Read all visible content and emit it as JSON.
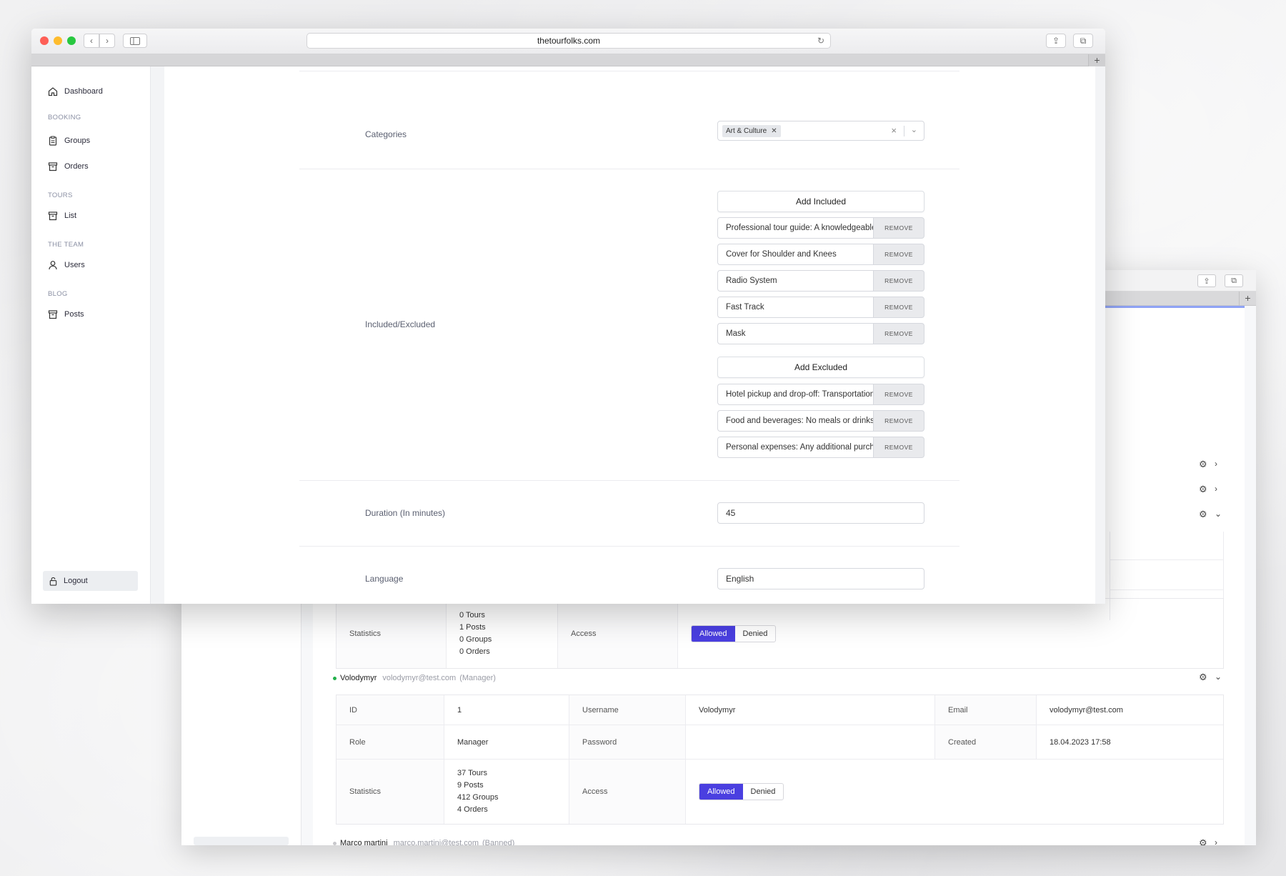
{
  "browser": {
    "url": "thetourfolks.com",
    "traffic_colors": [
      "#fe5f57",
      "#febc2e",
      "#28c840"
    ]
  },
  "sidebar": {
    "dashboard": "Dashboard",
    "sections": [
      {
        "title": "BOOKING",
        "items": [
          "Groups",
          "Orders"
        ]
      },
      {
        "title": "TOURS",
        "items": [
          "List"
        ]
      },
      {
        "title": "THE TEAM",
        "items": [
          "Users"
        ]
      },
      {
        "title": "BLOG",
        "items": [
          "Posts"
        ]
      }
    ],
    "logout": "Logout"
  },
  "form": {
    "categories": {
      "label": "Categories",
      "chips": [
        "Art & Culture"
      ]
    },
    "included_excluded": {
      "label": "Included/Excluded",
      "add_included": "Add Included",
      "included": [
        "Professional tour guide: A knowledgeable guide",
        "Cover for Shoulder and Knees",
        "Radio System",
        "Fast Track",
        "Mask"
      ],
      "add_excluded": "Add Excluded",
      "excluded": [
        "Hotel pickup and drop-off: Transportation",
        "Food and beverages: No meals or drinks",
        "Personal expenses: Any additional purchases"
      ],
      "remove_label": "REMOVE"
    },
    "duration": {
      "label": "Duration (In minutes)",
      "value": "45"
    },
    "language": {
      "label": "Language",
      "value": "English"
    }
  },
  "back_window": {
    "user_prev": {
      "stats_label": "Statistics",
      "stats": [
        "0 Tours",
        "1 Posts",
        "0 Groups",
        "0 Orders"
      ],
      "access_label": "Access",
      "allowed": "Allowed",
      "denied": "Denied"
    },
    "user": {
      "name": "Volodymyr",
      "email": "volodymyr@test.com",
      "role_tag": "(Manager)",
      "id_label": "ID",
      "id": "1",
      "username_label": "Username",
      "username": "Volodymyr",
      "email_label": "Email",
      "role_label": "Role",
      "role": "Manager",
      "password_label": "Password",
      "created_label": "Created",
      "created": "18.04.2023 17:58",
      "stats_label": "Statistics",
      "stats": [
        "37 Tours",
        "9 Posts",
        "412 Groups",
        "4 Orders"
      ],
      "access_label": "Access",
      "allowed": "Allowed",
      "denied": "Denied"
    },
    "next_user": {
      "name": "Marco martini",
      "email": "marco.martini@test.com",
      "role_tag": "(Banned)"
    },
    "accent": "#4a3fe0"
  }
}
